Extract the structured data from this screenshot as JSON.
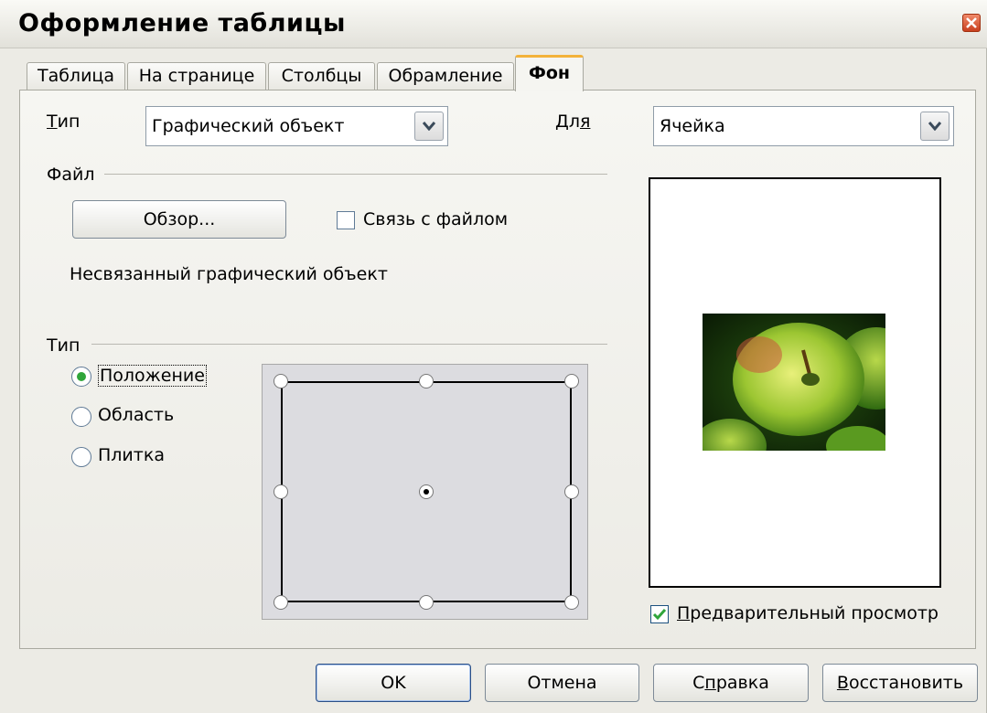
{
  "window": {
    "title": "Оформление таблицы"
  },
  "tabs": [
    {
      "label": "Таблица"
    },
    {
      "label": "На странице"
    },
    {
      "label": "Столбцы"
    },
    {
      "label": "Обрамление"
    },
    {
      "label": "Фон",
      "active": true
    }
  ],
  "type_row": {
    "type_label": "Тип",
    "type_value": "Графический объект",
    "for_label": "Для",
    "for_value": "Ячейка"
  },
  "file_section": {
    "label": "Файл",
    "browse_button": "Обзор...",
    "link_checkbox": {
      "label": "Связь с файлом",
      "checked": false
    },
    "status": "Несвязанный графический объект"
  },
  "type_section": {
    "label": "Тип",
    "options": [
      {
        "label": "Положение",
        "selected": true
      },
      {
        "label": "Область",
        "selected": false
      },
      {
        "label": "Плитка",
        "selected": false
      }
    ],
    "position_selected": "center"
  },
  "preview": {
    "checkbox_label": "Предварительный просмотр",
    "checked": true
  },
  "buttons": {
    "ok": "OK",
    "cancel": "Отмена",
    "help": "Справка",
    "reset": "Восстановить"
  },
  "colors": {
    "tab_highlight": "#f3b23a",
    "radio_dot": "#30a53a",
    "check_mark": "#30a53a",
    "close_button": "#d24a26"
  }
}
